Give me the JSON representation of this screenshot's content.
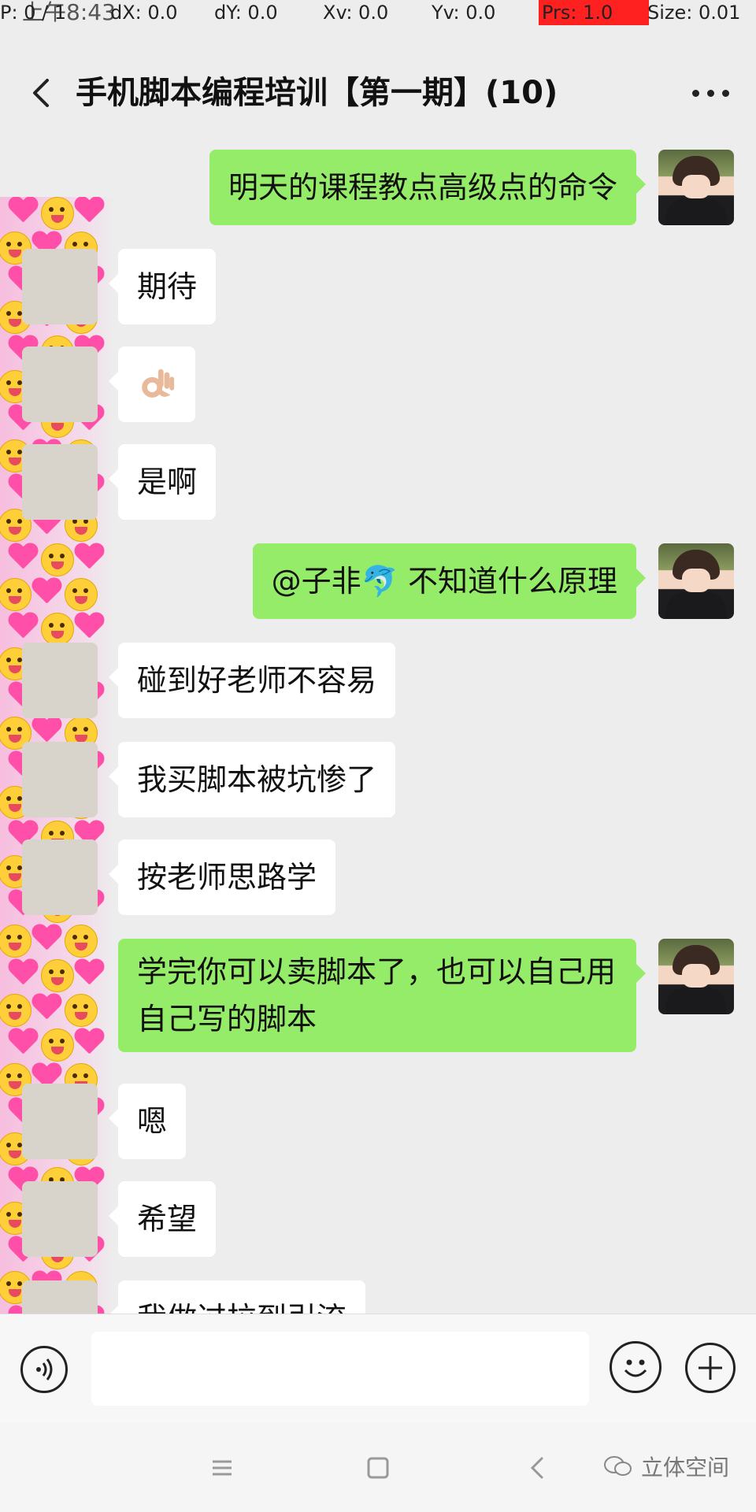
{
  "status": {
    "time": "上午8:43",
    "p": "P: 0 / 1",
    "dx": "dX: 0.0",
    "dy": "dY: 0.0",
    "xv": "Xv: 0.0",
    "yv": "Yv: 0.0",
    "prs": "Prs: 1.0",
    "size": "Size: 0.01",
    "prs_color": "#ff2020"
  },
  "header": {
    "title": "手机脚本编程培训【第一期】(10)",
    "back_icon": "chevron-left-icon",
    "more_icon": "more-dots-icon"
  },
  "messages": [
    {
      "side": "out",
      "text": "明天的课程教点高级点的命令"
    },
    {
      "side": "in",
      "text": "期待"
    },
    {
      "side": "in",
      "text": "",
      "icon": "ok-hand-icon"
    },
    {
      "side": "in",
      "text": "是啊"
    },
    {
      "side": "out",
      "text": "@子非🐬 不知道什么原理"
    },
    {
      "side": "in",
      "text": "碰到好老师不容易"
    },
    {
      "side": "in",
      "text": "我买脚本被坑惨了"
    },
    {
      "side": "in",
      "text": "按老师思路学"
    },
    {
      "side": "out",
      "text": "学完你可以卖脚本了，也可以自己用自己写的脚本"
    },
    {
      "side": "in",
      "text": "嗯"
    },
    {
      "side": "in",
      "text": "希望"
    },
    {
      "side": "in",
      "text": "我做过拉到引流"
    }
  ],
  "input": {
    "value": "",
    "voice_icon": "voice-icon",
    "emoji_icon": "emoji-icon",
    "plus_icon": "plus-icon"
  },
  "nav": {
    "menu_icon": "menu-icon",
    "home_icon": "home-icon",
    "back_icon": "back-icon"
  },
  "watermark": {
    "text": "立体空间"
  },
  "colors": {
    "outgoing_bubble": "#95ec69",
    "incoming_bubble": "#ffffff",
    "background": "#ededed"
  }
}
